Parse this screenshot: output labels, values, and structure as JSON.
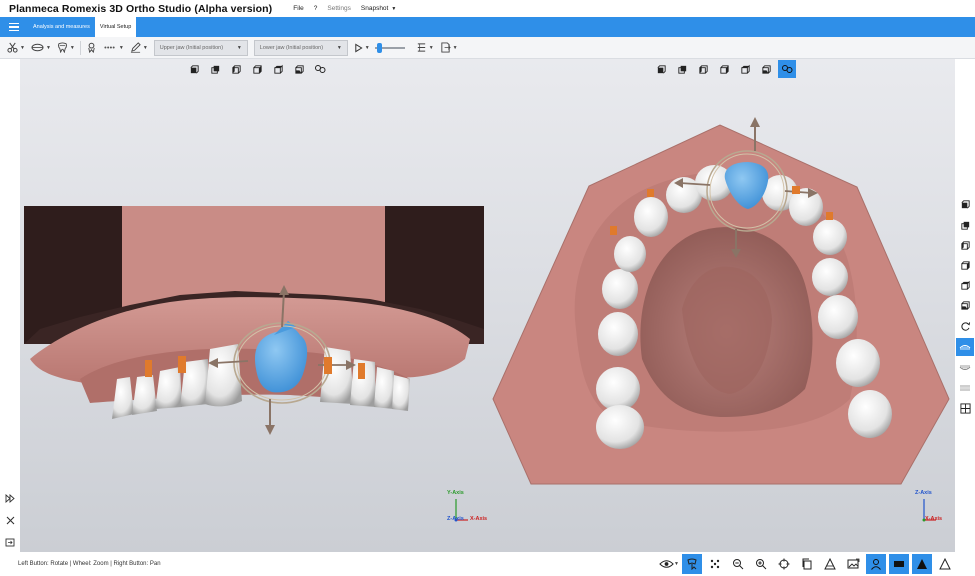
{
  "app": {
    "title": "Planmeca Romexis 3D Ortho Studio (Alpha version)"
  },
  "menu": {
    "file": "File",
    "help": "?",
    "settings": "Settings",
    "snapshot": "Snapshot"
  },
  "tabs": [
    {
      "label": "Analysis and measures",
      "active": false
    },
    {
      "label": "Virtual Setup",
      "active": true
    }
  ],
  "toolbar": {
    "upper_jaw_select": "Upper jaw (Initial position)",
    "lower_jaw_select": "Lower jaw (Initial position)"
  },
  "axes": {
    "left": {
      "y": "Y-Axis",
      "z": "Z-Axis",
      "x": "X-Axis"
    },
    "right": {
      "z": "Z-Axis",
      "x": "X-Axis"
    }
  },
  "status": {
    "hint": "Left Button: Rotate | Wheel: Zoom | Right Button: Pan"
  },
  "colors": {
    "accent": "#2f8fe8",
    "gum": "#c9837d",
    "selected_tooth": "#5aa8e6",
    "bracket": "#e07a2c"
  },
  "icons": {
    "view_cubes": [
      "cube-front-icon",
      "cube-back-icon",
      "cube-left-icon",
      "cube-right-icon",
      "cube-top-icon",
      "cube-bottom-icon",
      "camera-link-icon"
    ]
  }
}
